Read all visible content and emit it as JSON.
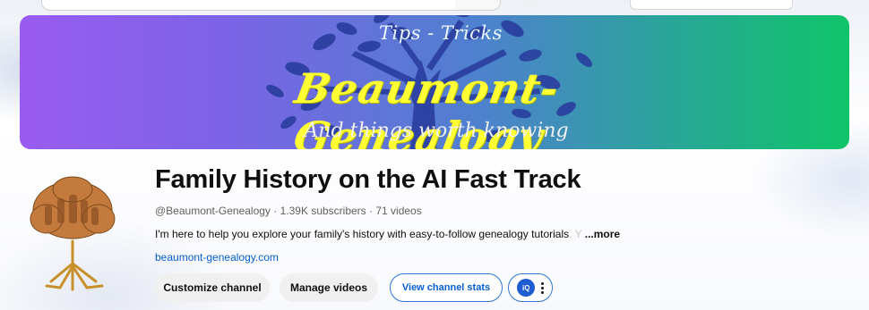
{
  "banner": {
    "top_text": "Tips - Tricks",
    "title": "Beaumont-Genealogy",
    "subtitle": "And things worth knowing"
  },
  "channel": {
    "title": "Family History on the AI Fast Track",
    "handle": "@Beaumont-Genealogy",
    "subscribers": "1.39K subscribers",
    "videos": "71 videos",
    "description": "I'm here to help you explore your family's history with easy-to-follow genealogy tutorials",
    "description_fade": ". Y",
    "more_label": "...more",
    "link": "beaumont-genealogy.com"
  },
  "actions": {
    "customize_label": "Customize channel",
    "manage_label": "Manage videos",
    "stats_label": "View channel stats",
    "extension_label": "iQ"
  },
  "colors": {
    "link": "#065fd4",
    "banner_title": "#ffff33",
    "tree": "#2a3e9e"
  }
}
